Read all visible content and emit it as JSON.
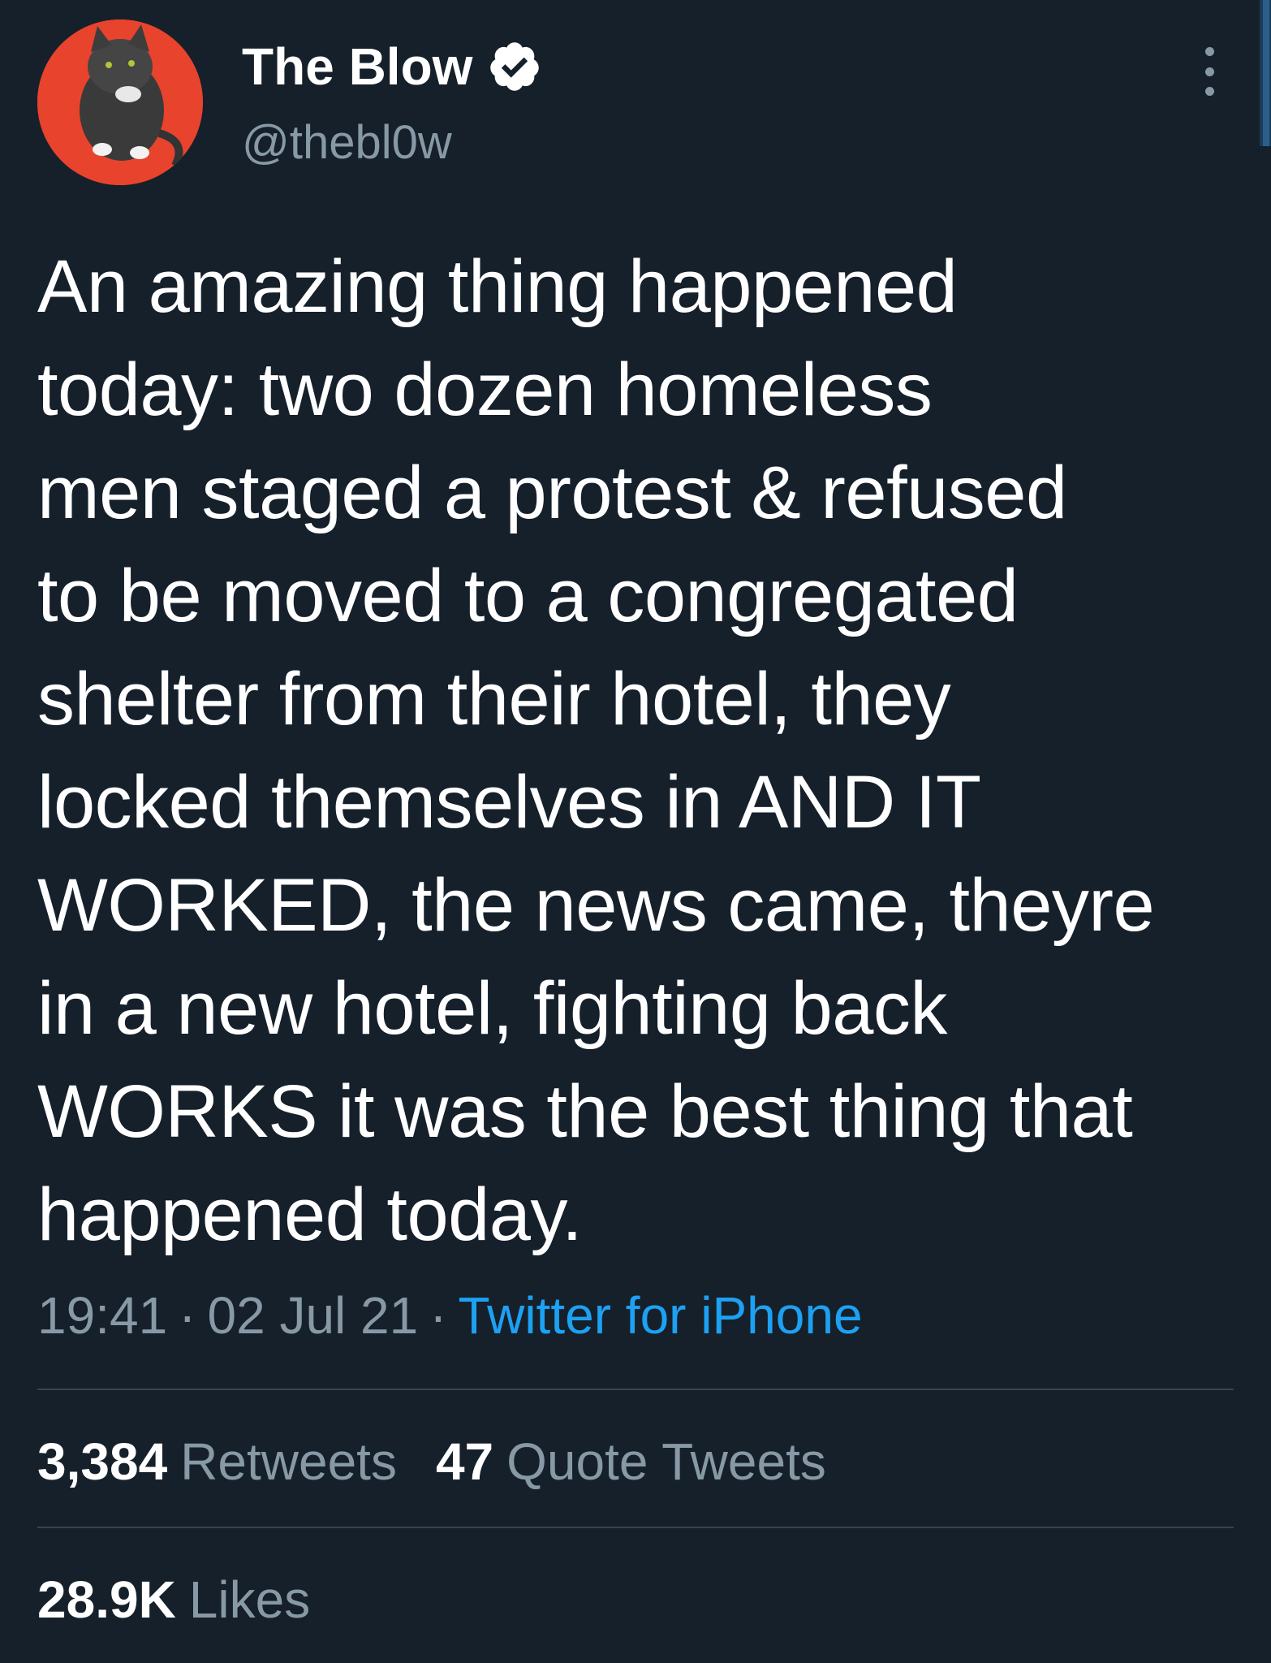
{
  "author": {
    "display_name": "The Blow",
    "handle": "@thebl0w",
    "verified": true
  },
  "tweet": {
    "text": "An amazing thing happened\ntoday: two dozen homeless\nmen staged a protest & refused\nto be moved to a congregated\nshelter from their hotel, they\nlocked themselves in AND IT\nWORKED, the news came, theyre\nin a new hotel, fighting back\nWORKS it was the best thing that\nhappened today.",
    "time": "19:41",
    "date": "02 Jul 21",
    "separator": "·",
    "source": "Twitter for iPhone"
  },
  "stats": {
    "retweets_count": "3,384",
    "retweets_label": "Retweets",
    "quotes_count": "47",
    "quotes_label": "Quote Tweets",
    "likes_count": "28.9K",
    "likes_label": "Likes"
  },
  "icons": {
    "verified": "verified-badge-icon",
    "more": "more-vertical-icon"
  },
  "colors": {
    "background": "#15202b",
    "text": "#ffffff",
    "secondary": "#8899a6",
    "link": "#1da1f2",
    "divider": "#38444d",
    "avatar_bg": "#e8432d"
  }
}
